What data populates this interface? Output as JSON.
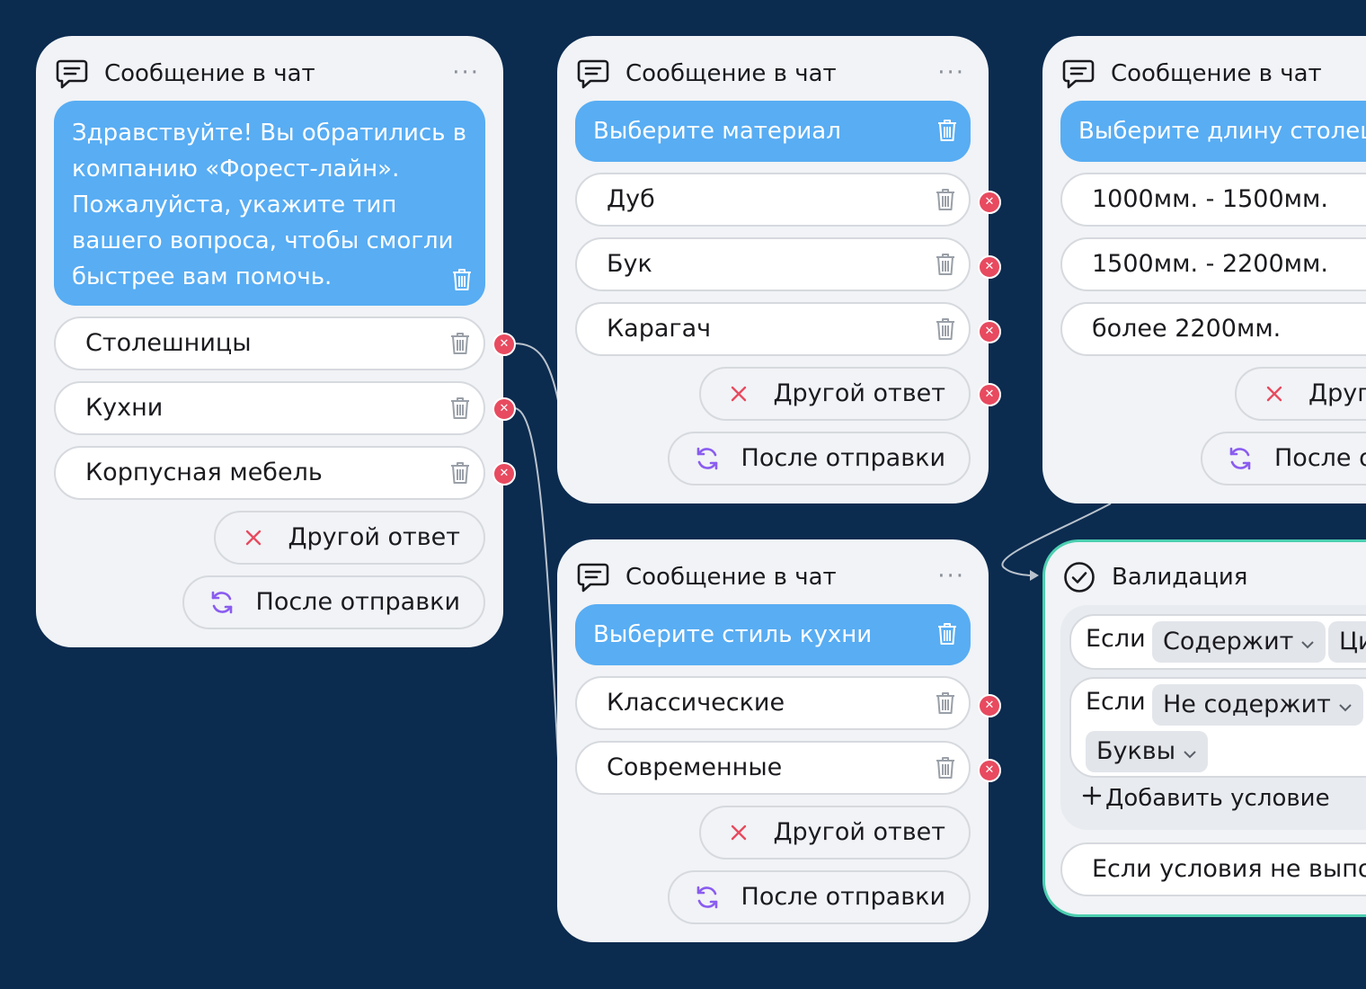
{
  "colors": {
    "background": "#0b2b4f",
    "card": "#f1f3f6",
    "accent": "#58adf3",
    "danger": "#e84a5f",
    "refresh": "#8a5cf0",
    "validation_border": "#4ccfb0"
  },
  "card1": {
    "title": "Сообщение в чат",
    "menu": "···",
    "message": "Здравствуйте! Вы обратились в компанию «Форест-лайн». Пожалуйста, укажите тип вашего вопроса, чтобы смогли быстрее вам помочь.",
    "options": [
      "Столешницы",
      "Кухни",
      "Корпусная мебель"
    ],
    "other": "Другой ответ",
    "after": "После отправки"
  },
  "card2": {
    "title": "Сообщение в чат",
    "menu": "···",
    "message": "Выберите материал",
    "options": [
      "Дуб",
      "Бук",
      "Карагач"
    ],
    "other": "Другой ответ",
    "after": "После отправки"
  },
  "card3": {
    "title": "Сообщение в чат",
    "message": "Выберите длину столеш",
    "options": [
      "1000мм. - 1500мм.",
      "1500мм. - 2200мм.",
      "более 2200мм."
    ],
    "other": "Друго",
    "after": "После о"
  },
  "card4": {
    "title": "Сообщение в чат",
    "menu": "···",
    "message": "Выберите стиль кухни",
    "options": [
      "Классические",
      "Современные"
    ],
    "other": "Другой ответ",
    "after": "После отправки"
  },
  "validation": {
    "title": "Валидация",
    "cond1": {
      "if": "Если",
      "op": "Содержит",
      "value": "Ци"
    },
    "cond2": {
      "if": "Если",
      "op": "Не содержит",
      "value": "Буквы"
    },
    "add": "Добавить условие",
    "fallback": "Если условия не выпол"
  },
  "icons": {
    "chat": "chat-bubble-icon",
    "trash": "trash-icon",
    "close": "close-icon",
    "refresh": "refresh-icon",
    "check": "check-circle-icon",
    "chevron": "chevron-down-icon",
    "plus": "plus-icon"
  }
}
